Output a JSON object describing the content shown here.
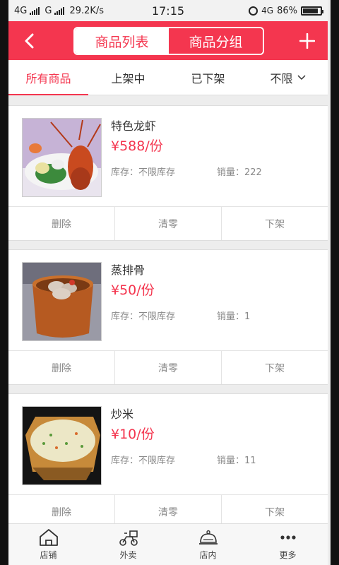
{
  "statusbar": {
    "network1": "4G",
    "network2": "G",
    "speed": "29.2K/s",
    "time": "17:15",
    "network3": "4G",
    "battery_label": "86%",
    "battery_level": 0.86
  },
  "header": {
    "seg_left": "商品列表",
    "seg_right": "商品分组",
    "back_icon": "chevron-left-icon",
    "add_icon": "plus-icon",
    "accent": "#f4364f"
  },
  "tabs": [
    {
      "label": "所有商品"
    },
    {
      "label": "上架中"
    },
    {
      "label": "已下架"
    },
    {
      "label": "不限"
    }
  ],
  "products": [
    {
      "name": "特色龙虾",
      "price": "¥588/份",
      "stock": "库存：不限库存",
      "sales": "销量：222",
      "actions": [
        "删除",
        "清零",
        "下架"
      ]
    },
    {
      "name": "蒸排骨",
      "price": "¥50/份",
      "stock": "库存：不限库存",
      "sales": "销量：1",
      "actions": [
        "删除",
        "清零",
        "下架"
      ]
    },
    {
      "name": "炒米",
      "price": "¥10/份",
      "stock": "库存：不限库存",
      "sales": "销量：11",
      "actions": [
        "删除",
        "清零",
        "下架"
      ]
    }
  ],
  "bottomnav": [
    {
      "label": "店铺",
      "icon": "home-icon"
    },
    {
      "label": "外卖",
      "icon": "scooter-icon"
    },
    {
      "label": "店内",
      "icon": "dish-cloche-icon"
    },
    {
      "label": "更多",
      "icon": "more-dots-icon"
    }
  ]
}
